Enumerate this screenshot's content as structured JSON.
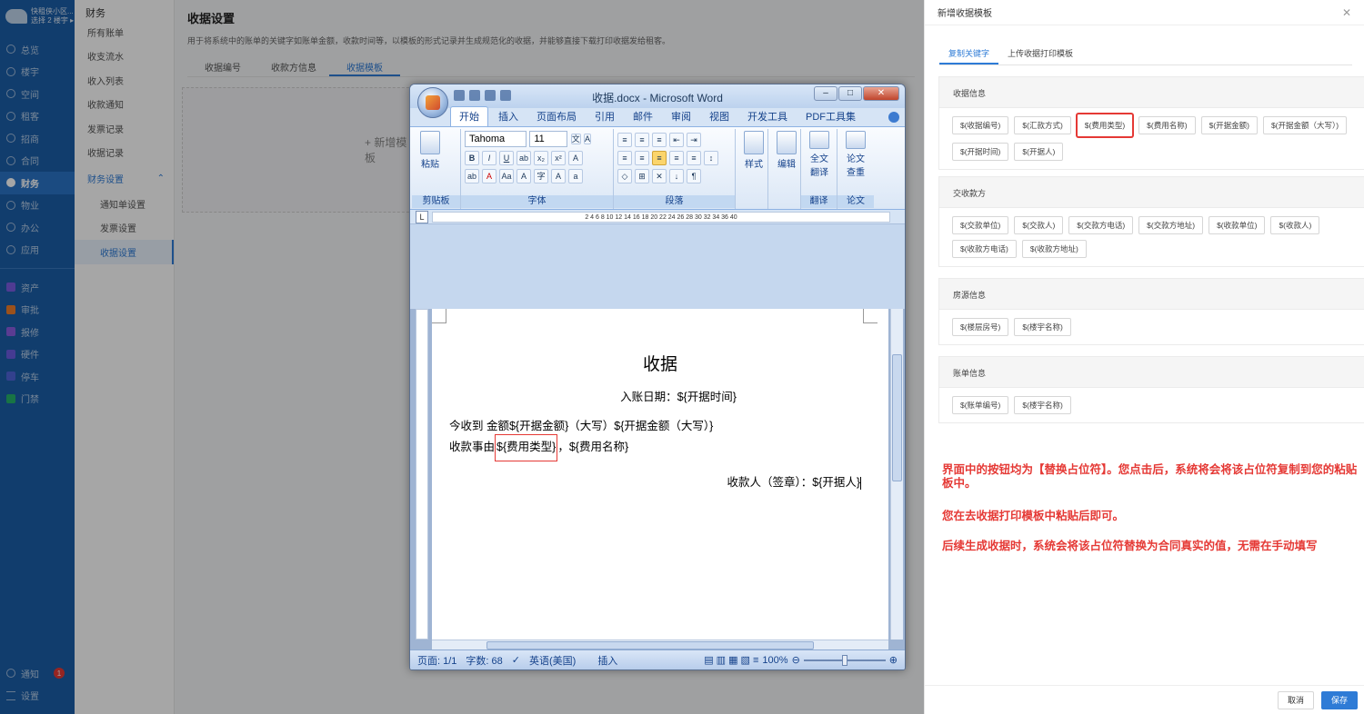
{
  "leftnav": {
    "brand_line1": "快租侠小区...",
    "brand_line2": "选择 2 楼宇 ▸",
    "items": [
      {
        "label": "总览"
      },
      {
        "label": "楼宇"
      },
      {
        "label": "空间"
      },
      {
        "label": "租客"
      },
      {
        "label": "招商"
      },
      {
        "label": "合同"
      },
      {
        "label": "财务",
        "active": true
      },
      {
        "label": "物业"
      },
      {
        "label": "办公"
      },
      {
        "label": "应用"
      }
    ],
    "modules": [
      {
        "label": "资产",
        "color": "#7a5be0"
      },
      {
        "label": "审批",
        "color": "#ee7d2a"
      },
      {
        "label": "报修",
        "color": "#8a5de0"
      },
      {
        "label": "硬件",
        "color": "#6a5be0"
      },
      {
        "label": "停车",
        "color": "#4f64d9"
      },
      {
        "label": "门禁",
        "color": "#25b36a"
      }
    ],
    "notify_label": "通知",
    "notify_count": "1",
    "settings_label": "设置"
  },
  "subnav": {
    "title": "财务",
    "items": [
      "所有账单",
      "收支流水",
      "收入列表",
      "收款通知",
      "发票记录",
      "收据记录"
    ],
    "group": "财务设置",
    "subitems": [
      "通知单设置",
      "发票设置",
      "收据设置"
    ]
  },
  "main": {
    "title": "收据设置",
    "desc": "用于将系统中的账单的关键字如账单金额，收款时间等，以模板的形式记录并生成规范化的收据，并能够直接下载打印收据发给租客。",
    "tabs": [
      "收据编号",
      "收款方信息",
      "收据模板"
    ],
    "add_template": "+ 新增模板"
  },
  "word": {
    "title": "收据.docx - Microsoft Word",
    "ribbon_tabs": [
      "开始",
      "插入",
      "页面布局",
      "引用",
      "邮件",
      "审阅",
      "视图",
      "开发工具",
      "PDF工具集"
    ],
    "font_name": "Tahoma",
    "font_size": "11",
    "groups": {
      "clipboard": "剪贴板",
      "font": "字体",
      "paragraph": "段落",
      "translate": "翻译",
      "paper": "论文"
    },
    "buttons": {
      "paste": "粘贴",
      "styles": "样式",
      "edit": "编辑",
      "fulltext_line1": "全文",
      "fulltext_line2": "翻译",
      "paper_line1": "论文",
      "paper_line2": "查重"
    },
    "ruler": "2 4 6 8 10 12 14 16 18 20 22 24 26 28 30 32 34 36 40",
    "doc": {
      "heading": "收据",
      "date_line": "入账日期：${开据时间}",
      "amount_line": "今收到 金额${开据金额}（大写）${开据金额（大写）}",
      "reason_prefix": "收款事由",
      "reason_highlight": "${费用类型}",
      "reason_suffix": "，${费用名称}",
      "signer_line": "收款人（签章）：${开据人}"
    },
    "status": {
      "page": "页面: 1/1",
      "words": "字数: 68",
      "lang": "英语(美国)",
      "mode": "插入",
      "zoom": "100%"
    }
  },
  "drawer": {
    "title": "新增收据模板",
    "tabs": [
      "复制关键字",
      "上传收据打印模板"
    ],
    "sections": [
      {
        "title": "收据信息",
        "keywords": [
          "$(收据编号)",
          "$(汇款方式)",
          "$(费用类型)",
          "$(费用名称)",
          "$(开据金额)",
          "$(开据金额（大写）)",
          "$(开据时间)",
          "$(开据人)"
        ],
        "selected": 2
      },
      {
        "title": "交收款方",
        "keywords": [
          "$(交款单位)",
          "$(交款人)",
          "$(交款方电话)",
          "$(交款方地址)",
          "$(收款单位)",
          "$(收款人)",
          "$(收款方电话)",
          "$(收款方地址)"
        ],
        "selected": -1
      },
      {
        "title": "房源信息",
        "keywords": [
          "$(楼层房号)",
          "$(楼宇名称)"
        ],
        "selected": -1
      },
      {
        "title": "账单信息",
        "keywords": [
          "$(账单编号)",
          "$(楼宇名称)"
        ],
        "selected": -1
      }
    ],
    "notes": [
      "界面中的按钮均为【替换占位符】。您点击后，系统将会将该占位符复制到您的粘贴板中。",
      "您在去收据打印模板中粘贴后即可。",
      "后续生成收据时，系统会将该占位符替换为合同真实的值，无需在手动填写"
    ],
    "cancel": "取消",
    "save": "保存"
  }
}
